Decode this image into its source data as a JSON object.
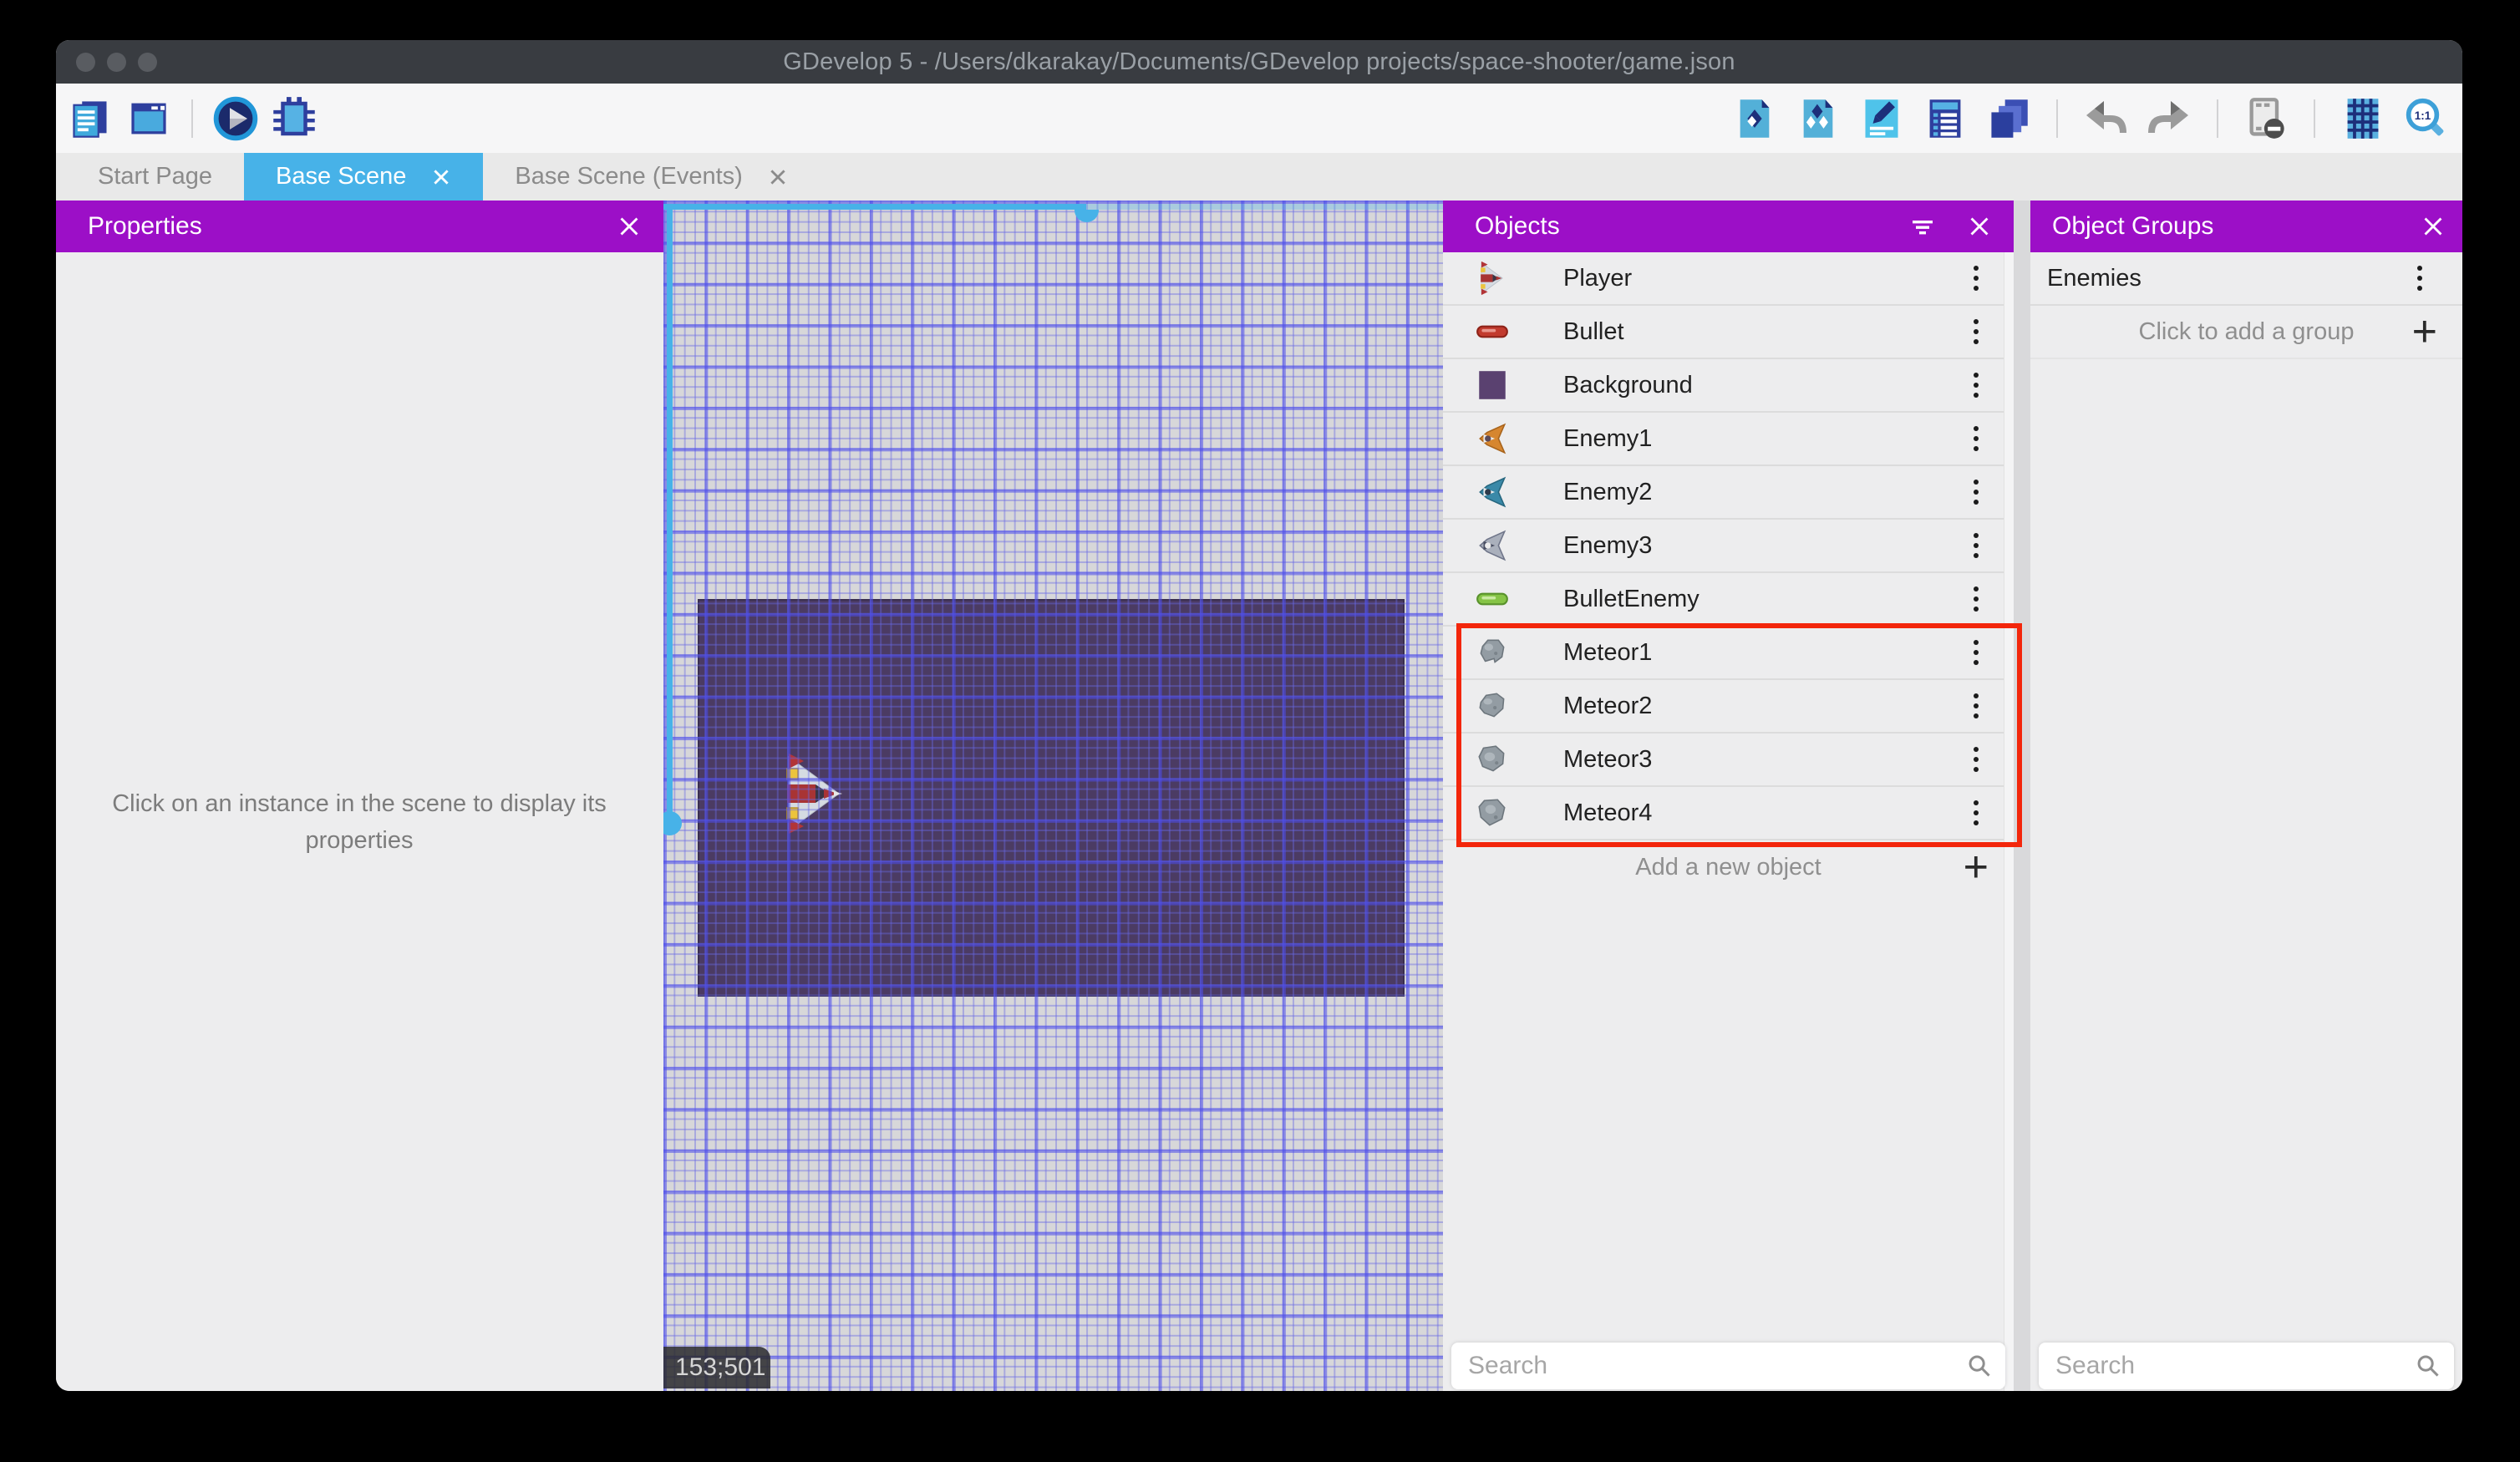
{
  "window": {
    "title": "GDevelop 5 - /Users/dkarakay/Documents/GDevelop projects/space-shooter/game.json"
  },
  "tabs": [
    {
      "label": "Start Page",
      "active": false
    },
    {
      "label": "Base Scene",
      "active": true
    },
    {
      "label": "Base Scene (Events)",
      "active": false
    }
  ],
  "properties_panel": {
    "title": "Properties",
    "hint": "Click on an instance in the scene to display its properties"
  },
  "scene_view": {
    "cursor_coordinates": "153;501"
  },
  "objects_panel": {
    "title": "Objects",
    "items": [
      {
        "label": "Player"
      },
      {
        "label": "Bullet"
      },
      {
        "label": "Background"
      },
      {
        "label": "Enemy1"
      },
      {
        "label": "Enemy2"
      },
      {
        "label": "Enemy3"
      },
      {
        "label": "BulletEnemy"
      },
      {
        "label": "Meteor1"
      },
      {
        "label": "Meteor2"
      },
      {
        "label": "Meteor3"
      },
      {
        "label": "Meteor4"
      }
    ],
    "highlighted_items": [
      "Meteor1",
      "Meteor2",
      "Meteor3",
      "Meteor4"
    ],
    "add_button_label": "Add a new object",
    "search_placeholder": "Search"
  },
  "object_groups_panel": {
    "title": "Object Groups",
    "groups": [
      {
        "label": "Enemies"
      }
    ],
    "add_button_label": "Click to add a group",
    "search_placeholder": "Search"
  },
  "icons": {
    "plus": "+",
    "zoom_ratio": "1:1"
  },
  "colors": {
    "accent_blue": "#47b2e8",
    "panel_header_purple": "#9c0fc7",
    "highlight_red": "#f3260b",
    "titlebar_bg": "#393c41"
  }
}
